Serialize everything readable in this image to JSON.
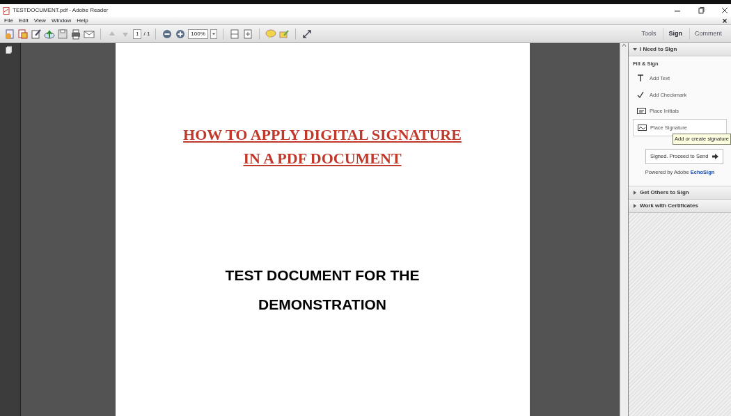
{
  "window": {
    "title": "TESTDOCUMENT.pdf - Adobe Reader"
  },
  "menu": [
    "File",
    "Edit",
    "View",
    "Window",
    "Help"
  ],
  "toolbar": {
    "page_number": "1",
    "page_count": "/ 1",
    "zoom": "100%"
  },
  "tabs": [
    {
      "label": "Tools",
      "selected": false
    },
    {
      "label": "Sign",
      "selected": true
    },
    {
      "label": "Comment",
      "selected": false
    }
  ],
  "document": {
    "title_lines": [
      "HOW TO APPLY DIGITAL SIGNATURE",
      "IN A PDF DOCUMENT"
    ],
    "body_lines": [
      "TEST DOCUMENT FOR THE",
      "DEMONSTRATION"
    ]
  },
  "sign_panel": {
    "sections": [
      {
        "label": "I Need to Sign",
        "expanded": true,
        "content": {
          "group": "Fill & Sign",
          "tools": [
            {
              "kind": "text",
              "label": "Add Text"
            },
            {
              "kind": "check",
              "label": "Add Checkmark"
            },
            {
              "kind": "initials",
              "label": "Place Initials"
            },
            {
              "kind": "signature",
              "label": "Place Signature"
            }
          ],
          "tooltip": "Add or create signature",
          "send_button": "Signed. Proceed to Send",
          "powered_by": "Powered by Adobe",
          "powered_link": "EchoSign"
        }
      },
      {
        "label": "Get Others to Sign",
        "expanded": false
      },
      {
        "label": "Work with Certificates",
        "expanded": false
      }
    ]
  }
}
